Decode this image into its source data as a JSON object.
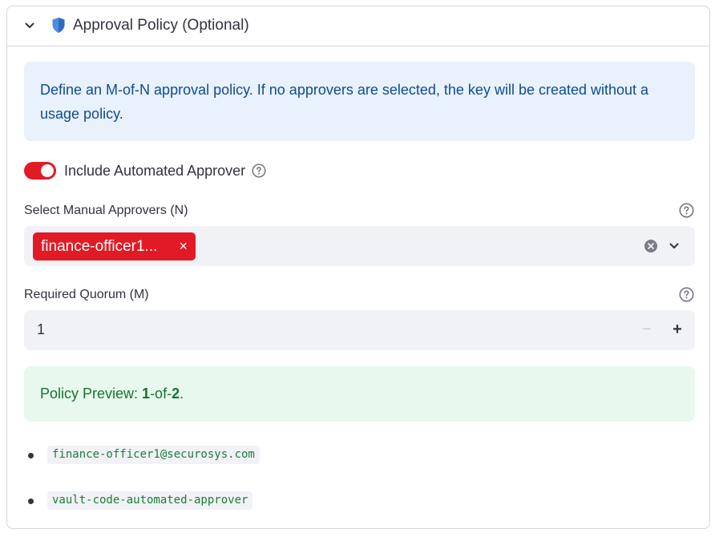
{
  "expander": {
    "title": "Approval Policy (Optional)",
    "icons": {
      "toggle": "chevron-down-icon",
      "badge": "shield-icon"
    }
  },
  "info": {
    "text": "Define an M-of-N approval policy. If no approvers are selected, the key will be created without a usage policy."
  },
  "automated_approver": {
    "label": "Include Automated Approver",
    "checked": true
  },
  "manual_approvers": {
    "label": "Select Manual Approvers (N)",
    "selected_tags": [
      "finance-officer1..."
    ],
    "remove_glyph": "×"
  },
  "quorum": {
    "label": "Required Quorum (M)",
    "value": "1",
    "minus": "−",
    "plus": "+"
  },
  "preview": {
    "prefix": "Policy Preview: ",
    "m": "1",
    "sep": "-of-",
    "n": "2",
    "suffix": "."
  },
  "approvers_list": [
    "finance-officer1@securosys.com",
    "vault-code-automated-approver"
  ],
  "colors": {
    "accent": "#e21a25",
    "info_bg": "#e9f1fc",
    "info_text": "#0e4d8f",
    "success_bg": "#e8f8ec",
    "success_text": "#177233",
    "input_bg": "#f0f2f6"
  }
}
